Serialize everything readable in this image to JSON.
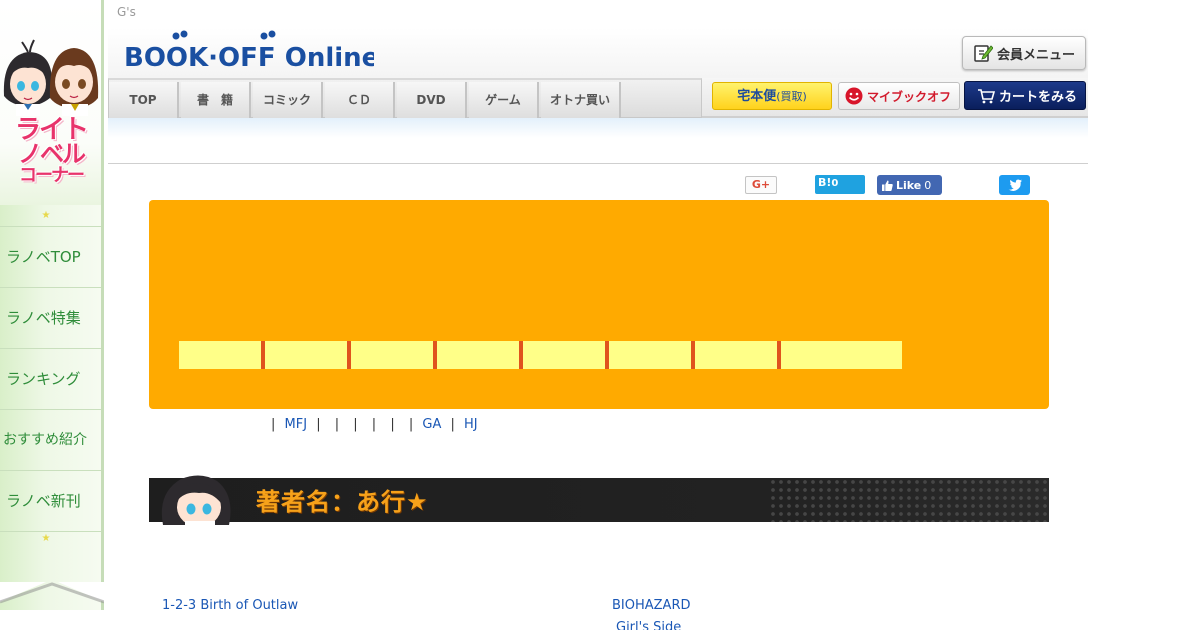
{
  "sidebar": {
    "corner_title_lines": [
      "ライト",
      "ノベル",
      "コーナー"
    ],
    "nav": [
      {
        "label": "ラノベTOP"
      },
      {
        "label": "ラノベ特集"
      },
      {
        "label": "ランキング"
      },
      {
        "label": "おすすめ紹介"
      },
      {
        "label": "ラノベ新刊"
      }
    ],
    "star_glyph": "★"
  },
  "header": {
    "gs_label": "G's",
    "logo_text": "BOOK·OFF Online",
    "member_menu": "会員メニュー",
    "tabs": [
      "TOP",
      "書　籍",
      "コミック",
      "ＣＤ",
      "DVD",
      "ゲーム",
      "オトナ買い"
    ],
    "takuhai_main": "宅本便",
    "takuhai_sub": "(買取)",
    "mybookoff": "マイブックオフ",
    "cart": "カートをみる"
  },
  "social": {
    "gplus": "G+",
    "hatena_logo": "B!",
    "hatena_count": "0",
    "fb_like": "Like",
    "fb_count": "0"
  },
  "publisher_links": {
    "mfj": "MFJ",
    "ga": "GA",
    "hj": "HJ",
    "pipe": "|"
  },
  "author_section": {
    "title": "著者名：あ行",
    "star": "★"
  },
  "books": [
    {
      "title": "1-2-3 Birth of Outlaw"
    },
    {
      "title": "BIOHAZARD"
    },
    {
      "title": "Girl's Side"
    }
  ],
  "colors": {
    "orange_panel": "#ffaa00",
    "label_tab": "#ffff88",
    "label_divider": "#e0531d",
    "link": "#1a57b5",
    "sidebar_text": "#2f8d3a",
    "corner_pink": "#e8336b"
  }
}
